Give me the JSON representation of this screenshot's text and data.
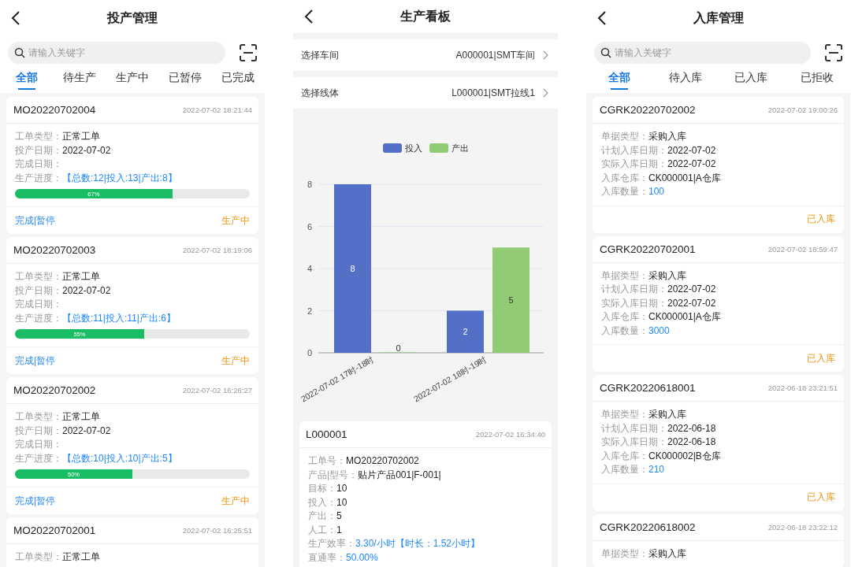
{
  "production_orders": {
    "title": "投产管理",
    "search": {
      "placeholder": "请输入关键字"
    },
    "tabs": [
      {
        "label": "全部",
        "selected": true
      },
      {
        "label": "待生产",
        "selected": false
      },
      {
        "label": "生产中",
        "selected": false
      },
      {
        "label": "已暂停",
        "selected": false
      },
      {
        "label": "已完成",
        "selected": false
      }
    ],
    "orders": [
      {
        "number": "MO20220702004",
        "time": "2022-07-02 18:21:44",
        "fields": [
          {
            "label": "工单类型：",
            "value": "正常工单",
            "kind": "plain"
          },
          {
            "label": "投产日期：",
            "value": "2022-07-02",
            "kind": "plain"
          },
          {
            "label": "完成日期：",
            "kind": "plain"
          },
          {
            "label": "生产进度：",
            "value": "【总数:12|投入:13|产出:8】",
            "kind": "accent"
          }
        ],
        "progress": {
          "level": 0.67,
          "reading": "67%"
        },
        "actions": "完成|暂停",
        "status": "生产中"
      },
      {
        "number": "MO20220702003",
        "time": "2022-07-02 18:19:06",
        "fields": [
          {
            "label": "工单类型：",
            "value": "正常工单",
            "kind": "plain"
          },
          {
            "label": "投产日期：",
            "value": "2022-07-02",
            "kind": "plain"
          },
          {
            "label": "完成日期：",
            "kind": "plain"
          },
          {
            "label": "生产进度：",
            "value": "【总数:11|投入:11|产出:6】",
            "kind": "accent"
          }
        ],
        "progress": {
          "level": 0.55,
          "reading": "55%"
        },
        "actions": "完成|暂停",
        "status": "生产中"
      },
      {
        "number": "MO20220702002",
        "time": "2022-07-02 16:26:27",
        "fields": [
          {
            "label": "工单类型：",
            "value": "正常工单",
            "kind": "plain"
          },
          {
            "label": "投产日期：",
            "value": "2022-07-02",
            "kind": "plain"
          },
          {
            "label": "完成日期：",
            "kind": "plain"
          },
          {
            "label": "生产进度：",
            "value": "【总数:10|投入:10|产出:5】",
            "kind": "accent"
          }
        ],
        "progress": {
          "level": 0.5,
          "reading": "50%"
        },
        "actions": "完成|暂停",
        "status": "生产中"
      },
      {
        "number": "MO20220702001",
        "time": "2022-07-02 16:25:51",
        "fields": [
          {
            "label": "工单类型：",
            "value": "正常工单",
            "kind": "plain"
          }
        ]
      }
    ]
  },
  "production_board": {
    "title": "生产看板",
    "selectors": [
      {
        "label": "选择车间",
        "value": "A000001|SMT车间"
      },
      {
        "label": "选择线体",
        "value": "L000001|SMT拉线1"
      }
    ],
    "chart_data": {
      "type": "bar",
      "categories": [
        "2022-07-02 17时-18时",
        "2022-07-02 18时-19时"
      ],
      "series": [
        {
          "name": "投入",
          "color": "#5470c6",
          "values": [
            8,
            2
          ]
        },
        {
          "name": "产出",
          "color": "#91cc75",
          "values": [
            0,
            5
          ]
        }
      ],
      "ylim": [
        0,
        8
      ],
      "yticks": [
        0,
        2,
        4,
        6,
        8
      ],
      "data_labels": true,
      "grid": true,
      "legend": true
    },
    "line_card": {
      "code": "L000001",
      "time": "2022-07-02 16:34:40",
      "fields": [
        {
          "label": "工单号：",
          "value": "MO20220702002",
          "kind": "plain"
        },
        {
          "label": "产品|型号：",
          "value": "贴片产品001|F-001|",
          "kind": "plain"
        },
        {
          "label": "目标：",
          "value": "10",
          "kind": "plain"
        },
        {
          "label": "投入：",
          "value": "10",
          "kind": "plain"
        },
        {
          "label": "产出：",
          "value": "5",
          "kind": "plain"
        },
        {
          "label": "人工：",
          "value": "1",
          "kind": "plain"
        },
        {
          "label": "生产效率：",
          "value": "3.30/小时【时长：1.52小时】",
          "kind": "accent"
        },
        {
          "label": "直通率：",
          "value": "50.00%",
          "kind": "accent"
        }
      ]
    }
  },
  "inbound": {
    "title": "入库管理",
    "search": {
      "placeholder": "请输入关键字"
    },
    "tabs": [
      {
        "label": "全部",
        "selected": true
      },
      {
        "label": "待入库",
        "selected": false
      },
      {
        "label": "已入库",
        "selected": false
      },
      {
        "label": "已拒收",
        "selected": false
      }
    ],
    "receipts": [
      {
        "number": "CGRK20220702002",
        "time": "2022-07-02 19:00:26",
        "fields": [
          {
            "label": "单据类型：",
            "value": "采购入库",
            "kind": "plain"
          },
          {
            "label": "计划入库日期：",
            "value": "2022-07-02",
            "kind": "plain"
          },
          {
            "label": "实际入库日期：",
            "value": "2022-07-02",
            "kind": "plain"
          },
          {
            "label": "入库仓库：",
            "value": "CK000001|A仓库",
            "kind": "plain"
          },
          {
            "label": "入库数量：",
            "value": "100",
            "kind": "accent"
          }
        ],
        "status": "已入库"
      },
      {
        "number": "CGRK20220702001",
        "time": "2022-07-02 18:59:47",
        "fields": [
          {
            "label": "单据类型：",
            "value": "采购入库",
            "kind": "plain"
          },
          {
            "label": "计划入库日期：",
            "value": "2022-07-02",
            "kind": "plain"
          },
          {
            "label": "实际入库日期：",
            "value": "2022-07-02",
            "kind": "plain"
          },
          {
            "label": "入库仓库：",
            "value": "CK000001|A仓库",
            "kind": "plain"
          },
          {
            "label": "入库数量：",
            "value": "3000",
            "kind": "accent"
          }
        ],
        "status": "已入库"
      },
      {
        "number": "CGRK20220618001",
        "time": "2022-06-18 23:21:51",
        "fields": [
          {
            "label": "单据类型：",
            "value": "采购入库",
            "kind": "plain"
          },
          {
            "label": "计划入库日期：",
            "value": "2022-06-18",
            "kind": "plain"
          },
          {
            "label": "实际入库日期：",
            "value": "2022-06-18",
            "kind": "plain"
          },
          {
            "label": "入库仓库：",
            "value": "CK000002|B仓库",
            "kind": "plain"
          },
          {
            "label": "入库数量：",
            "value": "210",
            "kind": "accent"
          }
        ],
        "status": "已入库"
      },
      {
        "number": "CGRK20220618002",
        "time": "2022-06-18 23:22:12",
        "fields": [
          {
            "label": "单据类型：",
            "value": "采购入库",
            "kind": "plain"
          }
        ]
      }
    ]
  }
}
